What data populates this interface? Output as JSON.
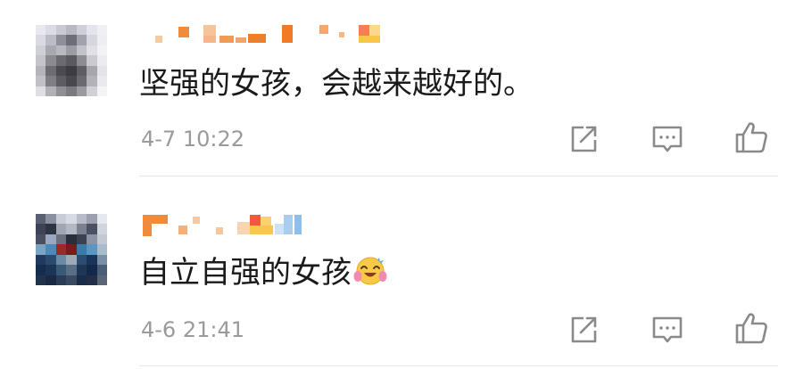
{
  "comments": [
    {
      "text": "坚强的女孩，会越来越好的。",
      "time": "4-7 10:22",
      "emoji": ""
    },
    {
      "text": "自立自强的女孩",
      "time": "4-6 21:41",
      "emoji": "hugging-face-emoji"
    }
  ],
  "icons": {
    "share": "share-icon",
    "reply": "comment-icon",
    "like": "thumbs-up-icon"
  },
  "colors": {
    "text": "#1a1a1a",
    "meta": "#9a9a9a",
    "icon": "#8a8a8a",
    "divider": "#e6e6e6",
    "emoji_face": "#f7c948"
  }
}
